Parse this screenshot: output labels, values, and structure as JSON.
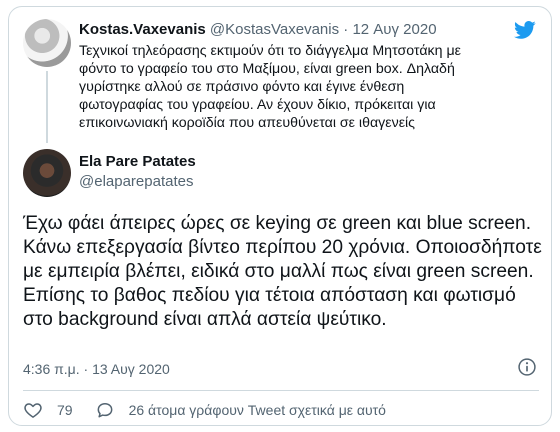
{
  "quoted": {
    "name": "Kostas.Vaxevanis",
    "handle": "@KostasVaxevanis",
    "separator": "·",
    "date": "12 Αυγ 2020",
    "text": "Τεχνικοί τηλεόρασης εκτιμούν ότι το διάγγελμα Μητσοτάκη με φόντο το γραφείο του στο Μαξίμου, είναι green box. Δηλαδή γυρίστηκε αλλού σε πράσινο φόντο και έγινε ένθεση φωτογραφίας του γραφείου. Αν έχουν δίκιο, πρόκειται για επικοινωνιακή κοροϊδία που απευθύνεται σε ιθαγενείς"
  },
  "main": {
    "name": "Ela Pare Patates",
    "handle": "@elaparepatates",
    "text": "Έχω φάει άπειρες ώρες σε keying σε green και blue screen. Κάνω επεξεργασία βίντεο περίπου 20 χρόνια. Οποιοσδήποτε με εμπειρία βλέπει, ειδικά στο μαλλί πως είναι green screen. Επίσης το βαθος πεδίου για τέτοια απόσταση και φωτισμό στο background είναι απλά αστεία ψεύτικο.",
    "timestamp": "4:36 π.μ. · 13 Αυγ 2020"
  },
  "actions": {
    "like_count": "79",
    "reply_label": "26 άτομα γράφουν Tweet σχετικά με αυτό"
  },
  "icons": {
    "brand": "twitter-bird-icon",
    "info": "info-icon",
    "like": "heart-icon",
    "reply": "comment-icon"
  },
  "colors": {
    "twitter_blue": "#1d9bf0",
    "muted": "#536471",
    "border": "#cfd9de"
  }
}
